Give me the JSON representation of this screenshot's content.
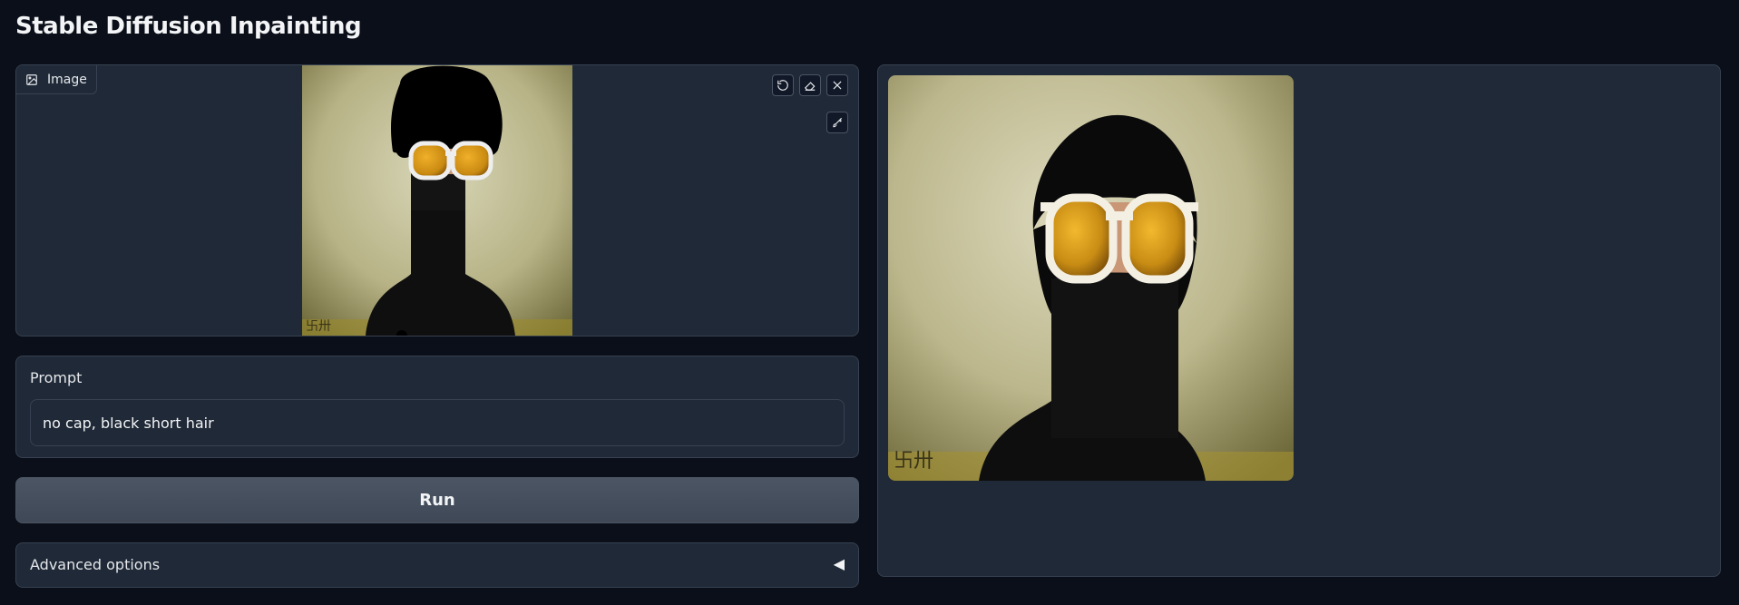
{
  "app": {
    "title": "Stable Diffusion Inpainting"
  },
  "editor": {
    "label": "Image",
    "tools": [
      "undo-icon",
      "eraser-icon",
      "close-icon",
      "brush-icon"
    ]
  },
  "prompt": {
    "label": "Prompt",
    "value": "no cap, black short hair",
    "placeholder": ""
  },
  "run": {
    "label": "Run"
  },
  "advanced": {
    "label": "Advanced options",
    "caret": "◀"
  },
  "colors": {
    "background": "#0b0f19",
    "panel": "#1f2937",
    "border": "#374151",
    "button": "#4b5563"
  }
}
